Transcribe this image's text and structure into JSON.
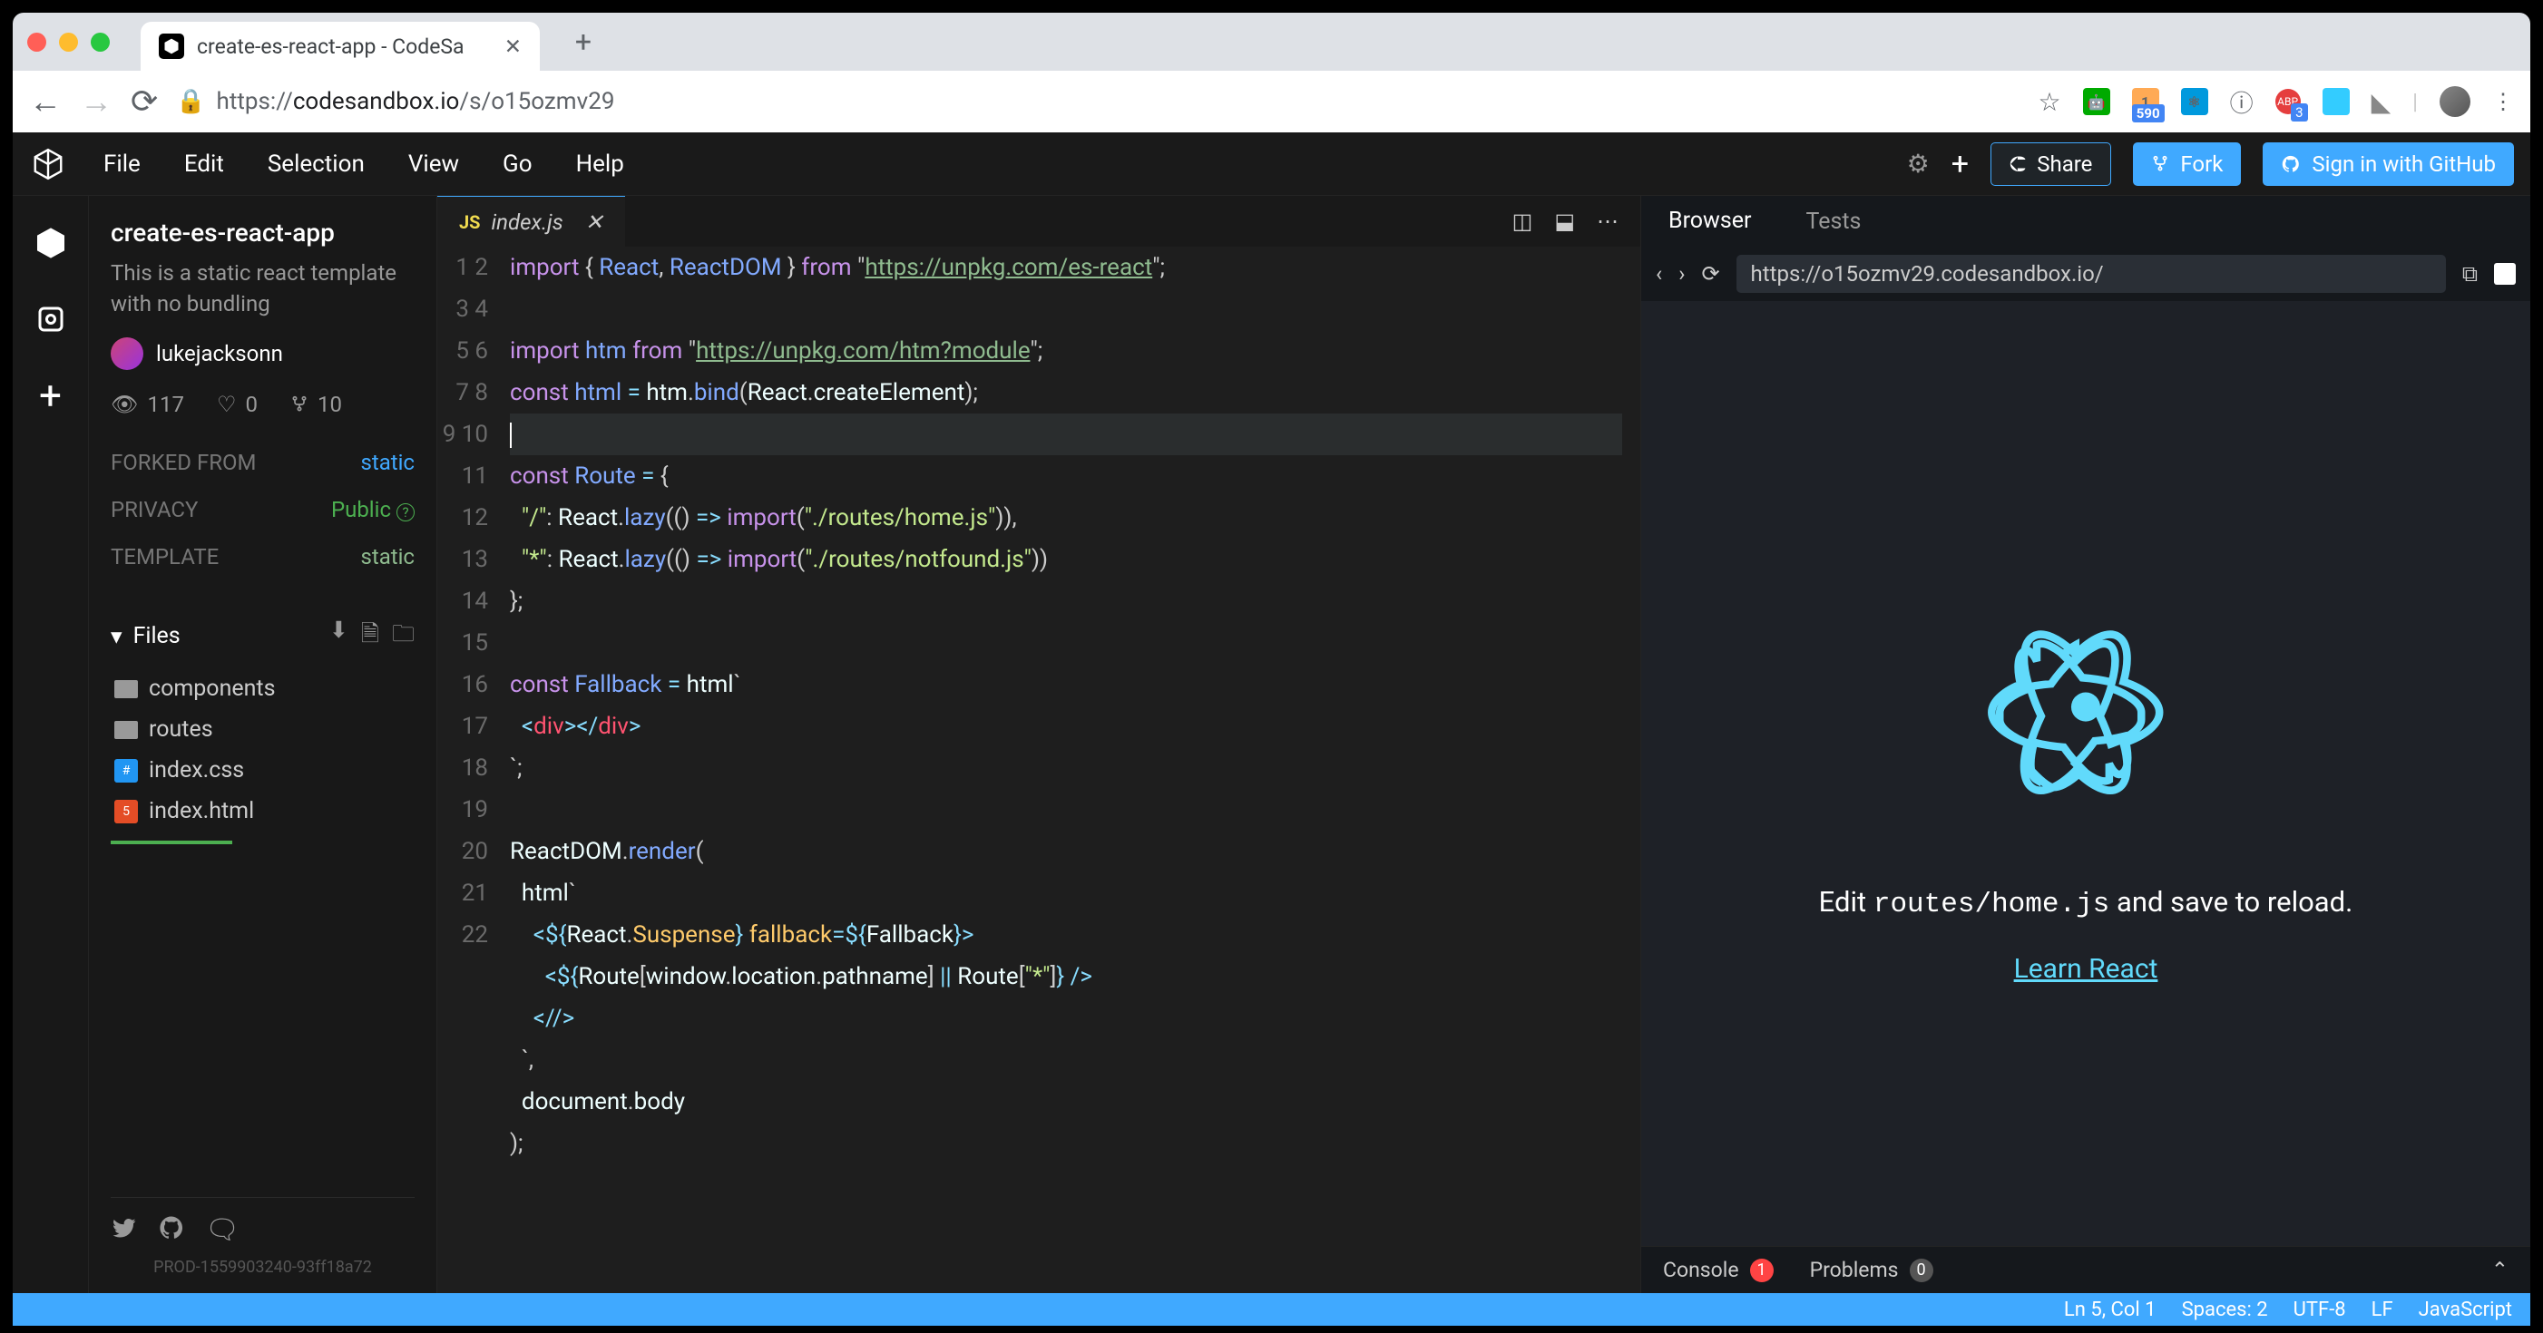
{
  "browser": {
    "tab_title": "create-es-react-app - CodeSa",
    "url_display_secure": "https://",
    "url_display_domain": "codesandbox.io",
    "url_display_path": "/s/o15ozmv29",
    "ext_badge_590": "590",
    "ext_badge_3": "3"
  },
  "app_menu": {
    "file": "File",
    "edit": "Edit",
    "selection": "Selection",
    "view": "View",
    "go": "Go",
    "help": "Help"
  },
  "header_buttons": {
    "share": "Share",
    "fork": "Fork",
    "github": "Sign in with GitHub"
  },
  "sidebar": {
    "title": "create-es-react-app",
    "description": "This is a static react template with no bundling",
    "author": "lukejacksonn",
    "stats": {
      "views": "117",
      "likes": "0",
      "forks": "10"
    },
    "forked_label": "FORKED FROM",
    "forked_val": "static",
    "privacy_label": "PRIVACY",
    "privacy_val": "Public",
    "template_label": "TEMPLATE",
    "template_val": "static",
    "files_label": "Files",
    "files": {
      "components": "components",
      "routes": "routes",
      "index_css": "index.css",
      "index_html": "index.html"
    },
    "build": "PROD-1559903240-93ff18a72"
  },
  "editor": {
    "tab_name": "index.js",
    "code_lines": [
      "import { React, ReactDOM } from \"https://unpkg.com/es-react\";",
      "",
      "import htm from \"https://unpkg.com/htm?module\";",
      "const html = htm.bind(React.createElement);",
      "",
      "const Route = {",
      "  \"/\": React.lazy(() => import(\"./routes/home.js\")),",
      "  \"*\": React.lazy(() => import(\"./routes/notfound.js\"))",
      "};",
      "",
      "const Fallback = html`",
      "  <div></div>",
      "`;",
      "",
      "ReactDOM.render(",
      "  html`",
      "    <${React.Suspense} fallback=${Fallback}>",
      "      <${Route[window.location.pathname] || Route[\"*\"]} />",
      "    <//>",
      "  `,",
      "  document.body",
      ");"
    ]
  },
  "preview": {
    "tab_browser": "Browser",
    "tab_tests": "Tests",
    "url": "https://o15ozmv29.codesandbox.io/",
    "edit_text_pre": "Edit ",
    "edit_text_code": "routes/home.js",
    "edit_text_post": " and save to reload.",
    "learn": "Learn React",
    "console_label": "Console",
    "console_count": "1",
    "problems_label": "Problems",
    "problems_count": "0"
  },
  "status": {
    "pos": "Ln 5, Col 1",
    "spaces": "Spaces: 2",
    "encoding": "UTF-8",
    "eol": "LF",
    "lang": "JavaScript"
  }
}
